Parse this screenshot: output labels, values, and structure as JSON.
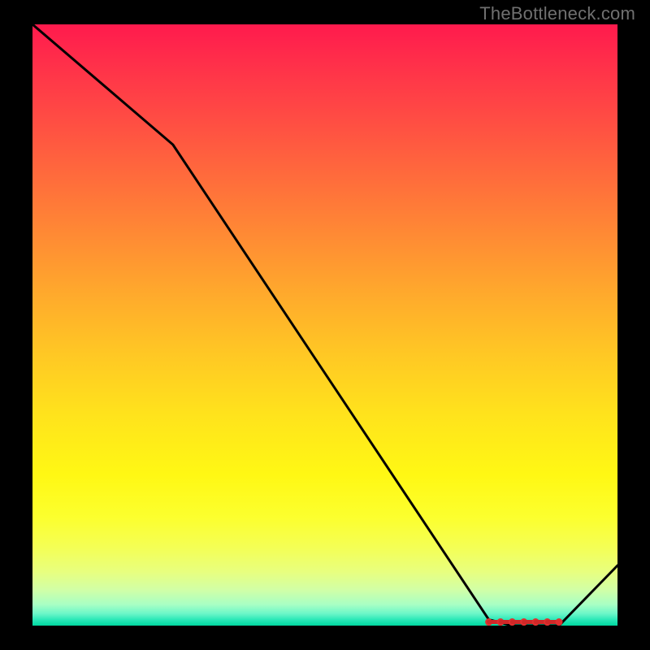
{
  "watermark": "TheBottleneck.com",
  "chart_data": {
    "type": "line",
    "title": "",
    "xlabel": "",
    "ylabel": "",
    "xlim": [
      0,
      100
    ],
    "ylim": [
      0,
      100
    ],
    "series": [
      {
        "name": "curve",
        "x": [
          0,
          24,
          78,
          82,
          90,
          100
        ],
        "values": [
          100,
          80,
          1,
          0,
          0,
          10
        ]
      }
    ],
    "markers": {
      "name": "bottom-cluster",
      "x": [
        78,
        80,
        82,
        84,
        86,
        88,
        90
      ],
      "values": [
        0.6,
        0.6,
        0.6,
        0.6,
        0.6,
        0.6,
        0.6
      ]
    },
    "gradient_stops": [
      {
        "pct": 0,
        "color": "#ff1a4d"
      },
      {
        "pct": 50,
        "color": "#ffc020"
      },
      {
        "pct": 80,
        "color": "#fff814"
      },
      {
        "pct": 100,
        "color": "#00d8a0"
      }
    ]
  }
}
